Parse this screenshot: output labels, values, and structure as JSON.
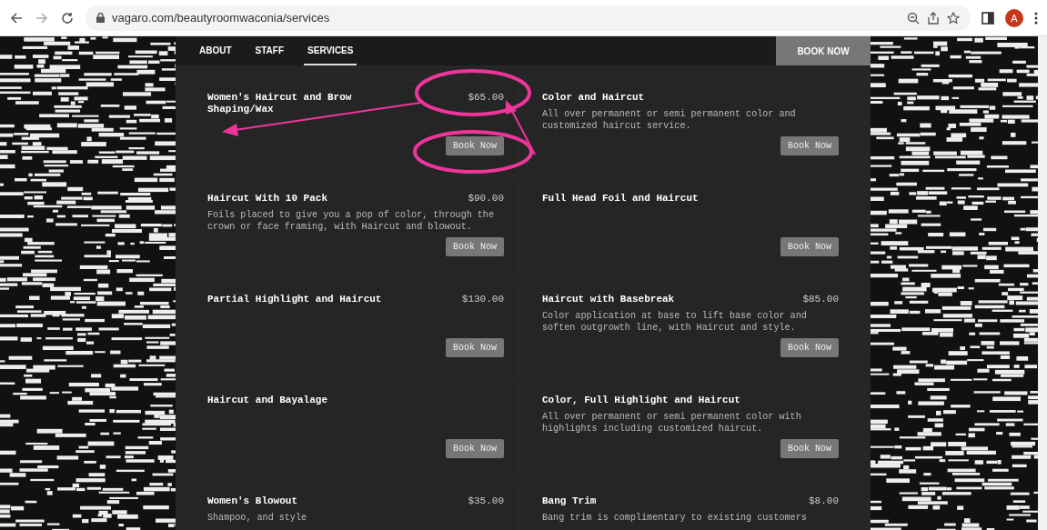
{
  "browser": {
    "url": "vagaro.com/beautyroomwaconia/services",
    "avatar": "A"
  },
  "nav": {
    "tabs": [
      {
        "label": "ABOUT",
        "selected": false
      },
      {
        "label": "STAFF",
        "selected": false
      },
      {
        "label": "SERVICES",
        "selected": true
      }
    ],
    "book_button": "BOOK NOW"
  },
  "services": [
    {
      "name": "Women's Haircut and Brow Shaping/Wax",
      "price": "$65.00",
      "button": "Book Now"
    },
    {
      "name": "Color and Haircut",
      "description": "All over permanent or semi permanent color and customized haircut service.",
      "button": "Book Now"
    },
    {
      "name": "Haircut With 10 Pack",
      "price": "$90.00",
      "description": "Foils placed to give you a pop of color, through the crown or face framing, with Haircut and blowout.",
      "button": "Book Now"
    },
    {
      "name": "Full Head Foil and Haircut",
      "button": "Book Now"
    },
    {
      "name": "Partial Highlight and Haircut",
      "price": "$130.00",
      "button": "Book Now"
    },
    {
      "name": "Haircut with Basebreak",
      "price": "$85.00",
      "description": "Color application at base to lift base color and soften outgrowth line, with Haircut and style.",
      "button": "Book Now"
    },
    {
      "name": "Haircut and Bayalage",
      "button": "Book Now"
    },
    {
      "name": "Color, Full Highlight and Haircut",
      "description": "All over permanent or semi permanent color with highlights including customized haircut.",
      "button": "Book Now"
    },
    {
      "name": "Women's Blowout",
      "price": "$35.00",
      "description": "Shampoo, and style"
    },
    {
      "name": "Bang Trim",
      "price": "$8.00",
      "description": "Bang trim is complimentary to existing customers"
    }
  ]
}
